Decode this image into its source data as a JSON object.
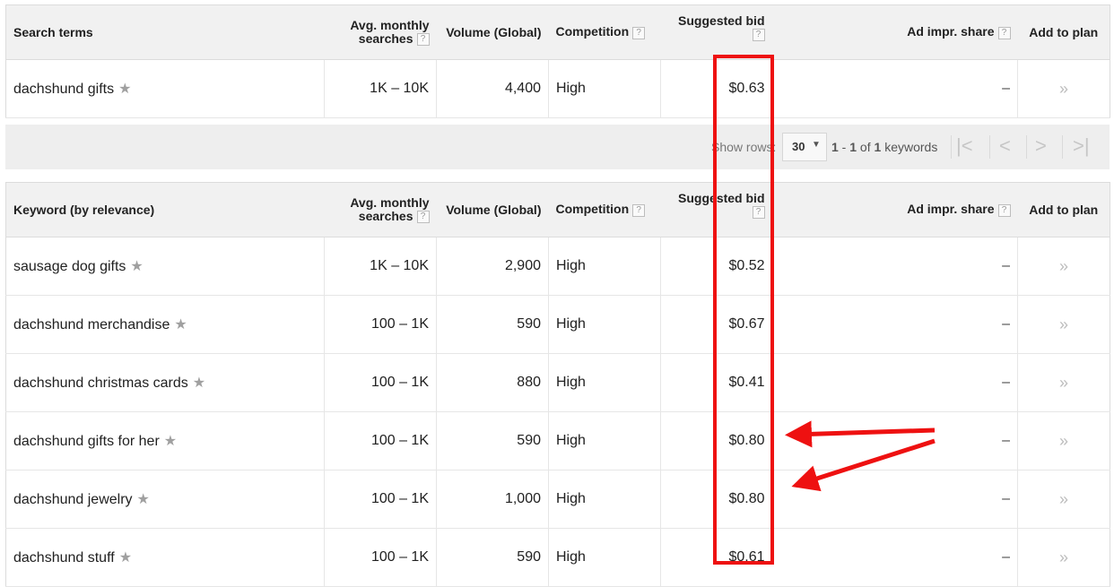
{
  "columns": {
    "search_terms": "Search terms",
    "keyword": "Keyword (by relevance)",
    "avg_monthly_1": "Avg. monthly",
    "avg_monthly_2": "searches",
    "volume": "Volume (Global)",
    "competition": "Competition",
    "suggested_bid": "Suggested bid",
    "ad_impr": "Ad impr. share",
    "add_to_plan": "Add to plan",
    "help": "?"
  },
  "search_terms_rows": [
    {
      "keyword": "dachshund gifts",
      "avg": "1K – 10K",
      "volume": "4,400",
      "competition": "High",
      "bid": "$0.63",
      "impr": "–",
      "plan": "»"
    }
  ],
  "pagination": {
    "show_rows_label": "Show rows:",
    "rows_value": "30",
    "range_a": "1",
    "range_sep": " - ",
    "range_b": "1",
    "range_of": " of ",
    "range_total": "1",
    "range_suffix": " keywords"
  },
  "keyword_rows": [
    {
      "keyword": "sausage dog gifts",
      "avg": "1K – 10K",
      "volume": "2,900",
      "competition": "High",
      "bid": "$0.52",
      "impr": "–",
      "plan": "»"
    },
    {
      "keyword": "dachshund merchandise",
      "avg": "100 – 1K",
      "volume": "590",
      "competition": "High",
      "bid": "$0.67",
      "impr": "–",
      "plan": "»"
    },
    {
      "keyword": "dachshund christmas cards",
      "avg": "100 – 1K",
      "volume": "880",
      "competition": "High",
      "bid": "$0.41",
      "impr": "–",
      "plan": "»"
    },
    {
      "keyword": "dachshund gifts for her",
      "avg": "100 – 1K",
      "volume": "590",
      "competition": "High",
      "bid": "$0.80",
      "impr": "–",
      "plan": "»"
    },
    {
      "keyword": "dachshund jewelry",
      "avg": "100 – 1K",
      "volume": "1,000",
      "competition": "High",
      "bid": "$0.80",
      "impr": "–",
      "plan": "»"
    },
    {
      "keyword": "dachshund stuff",
      "avg": "100 – 1K",
      "volume": "590",
      "competition": "High",
      "bid": "$0.61",
      "impr": "–",
      "plan": "»"
    }
  ],
  "icons": {
    "star": "star-icon",
    "help": "help-icon",
    "dropdown": "caret-down-icon",
    "first": "first-page-icon",
    "prev": "prev-page-icon",
    "next": "next-page-icon",
    "last": "last-page-icon",
    "add": "double-chevron-icon"
  },
  "colors": {
    "highlight": "#ee1111",
    "header_bg": "#f1f1f1",
    "toolbar_bg": "#eeeeee"
  }
}
